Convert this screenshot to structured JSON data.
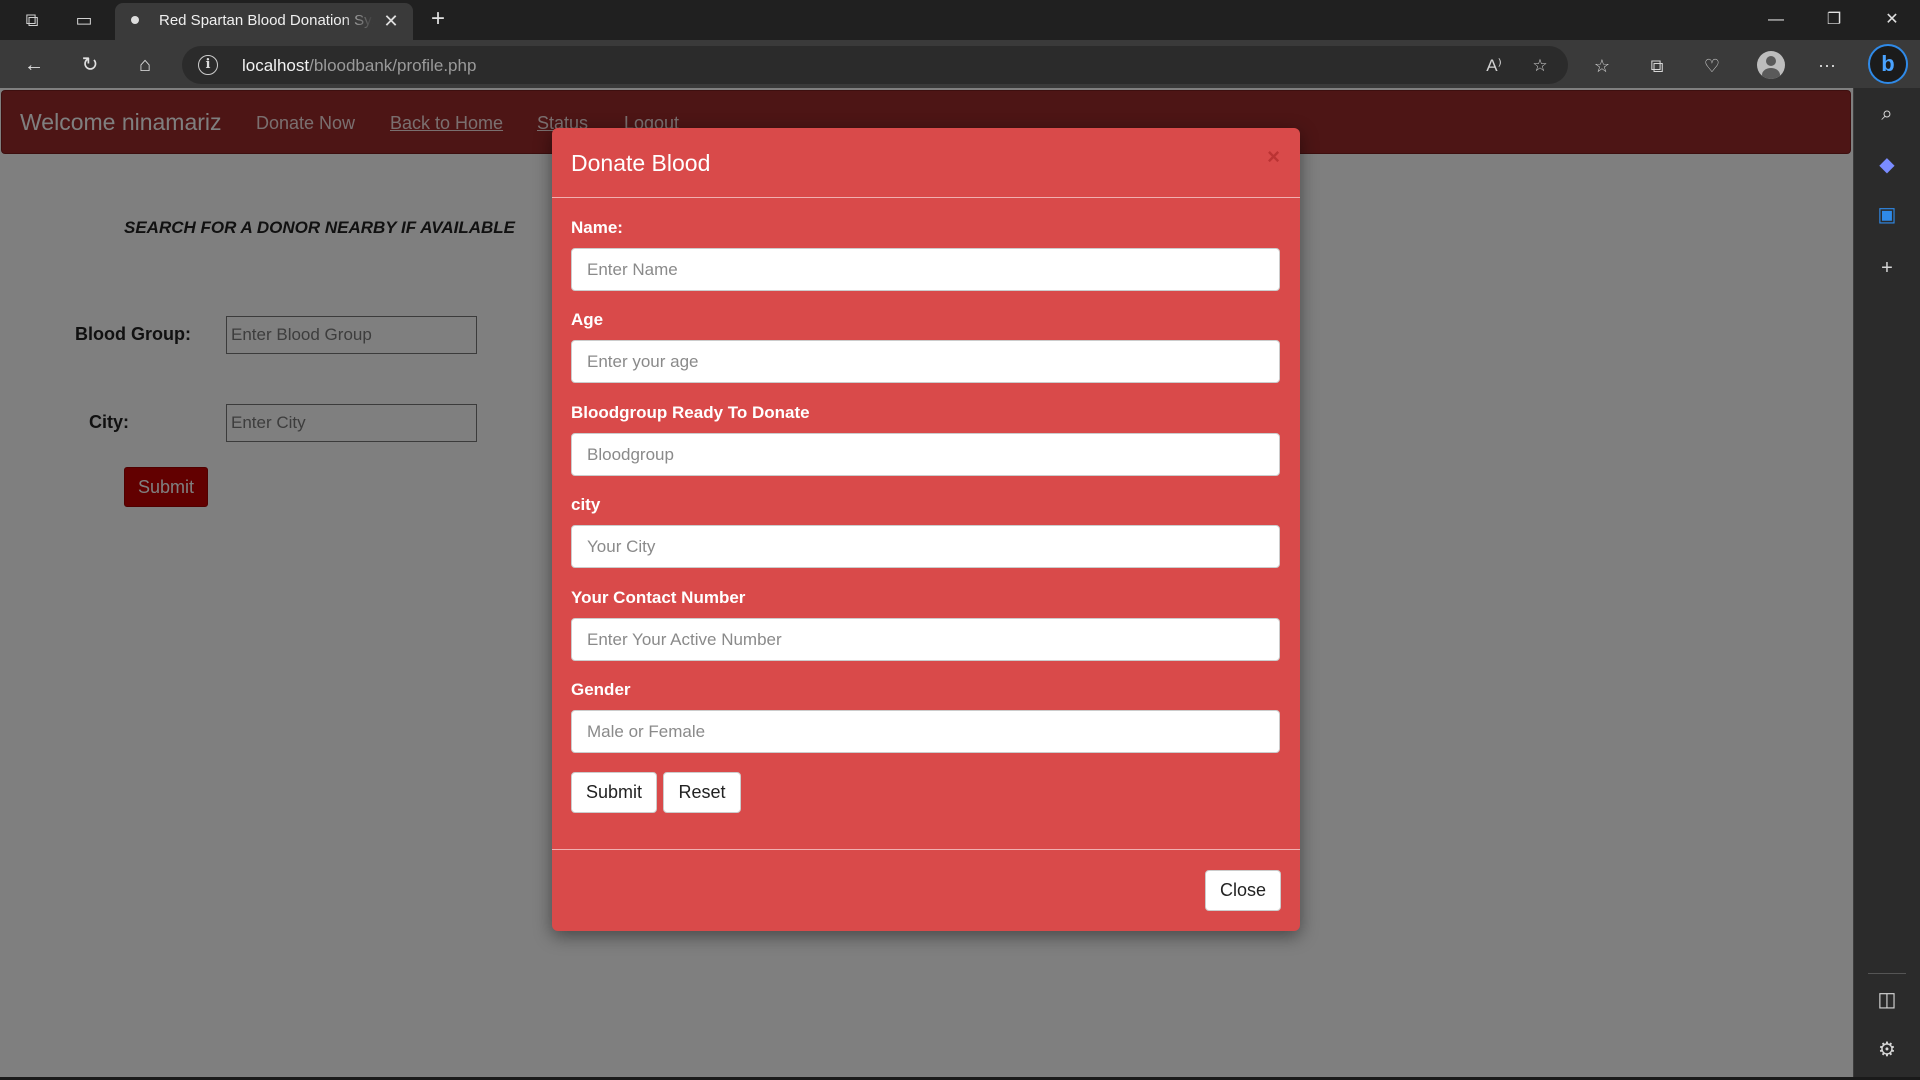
{
  "browser": {
    "tab_title": "Red Spartan Blood Donation Syst",
    "tab_close": "✕",
    "new_tab": "+",
    "window_controls": {
      "minimize": "—",
      "restore": "❐",
      "close": "✕"
    },
    "address": {
      "host": "localhost",
      "path": "/bloodbank/profile.php"
    },
    "icons": [
      "workspaces-icon",
      "tab-actions-icon",
      "back-icon",
      "refresh-icon",
      "home-icon",
      "read-aloud-icon",
      "add-favorite-icon",
      "favorites-icon",
      "collections-icon",
      "browser-essentials-icon",
      "profile-icon",
      "more-icon",
      "bing-chat-icon"
    ]
  },
  "navbar": {
    "brand": "Welcome ninamariz",
    "links": [
      "Donate Now",
      "Back to Home",
      "Status",
      "Logout"
    ]
  },
  "search": {
    "heading": "SEARCH FOR A DONOR NEARBY IF AVAILABLE",
    "blood_group_label": "Blood Group:",
    "blood_group_placeholder": "Enter Blood Group",
    "city_label": "City:",
    "city_placeholder": "Enter City",
    "submit_label": "Submit"
  },
  "modal": {
    "title": "Donate Blood",
    "close_x": "×",
    "fields": [
      {
        "label": "Name:",
        "placeholder": "Enter Name"
      },
      {
        "label": "Age",
        "placeholder": "Enter your age"
      },
      {
        "label": "Bloodgroup Ready To Donate",
        "placeholder": "Bloodgroup"
      },
      {
        "label": "city",
        "placeholder": "Your City"
      },
      {
        "label": "Your Contact Number",
        "placeholder": "Enter Your Active Number"
      },
      {
        "label": "Gender",
        "placeholder": "Male or Female"
      }
    ],
    "submit_label": "Submit",
    "reset_label": "Reset",
    "close_label": "Close"
  },
  "colors": {
    "navbar": "#9b2a2a",
    "modal": "#d94a4a",
    "search_submit": "#c40000",
    "edge_accent": "#2f8ae8"
  }
}
